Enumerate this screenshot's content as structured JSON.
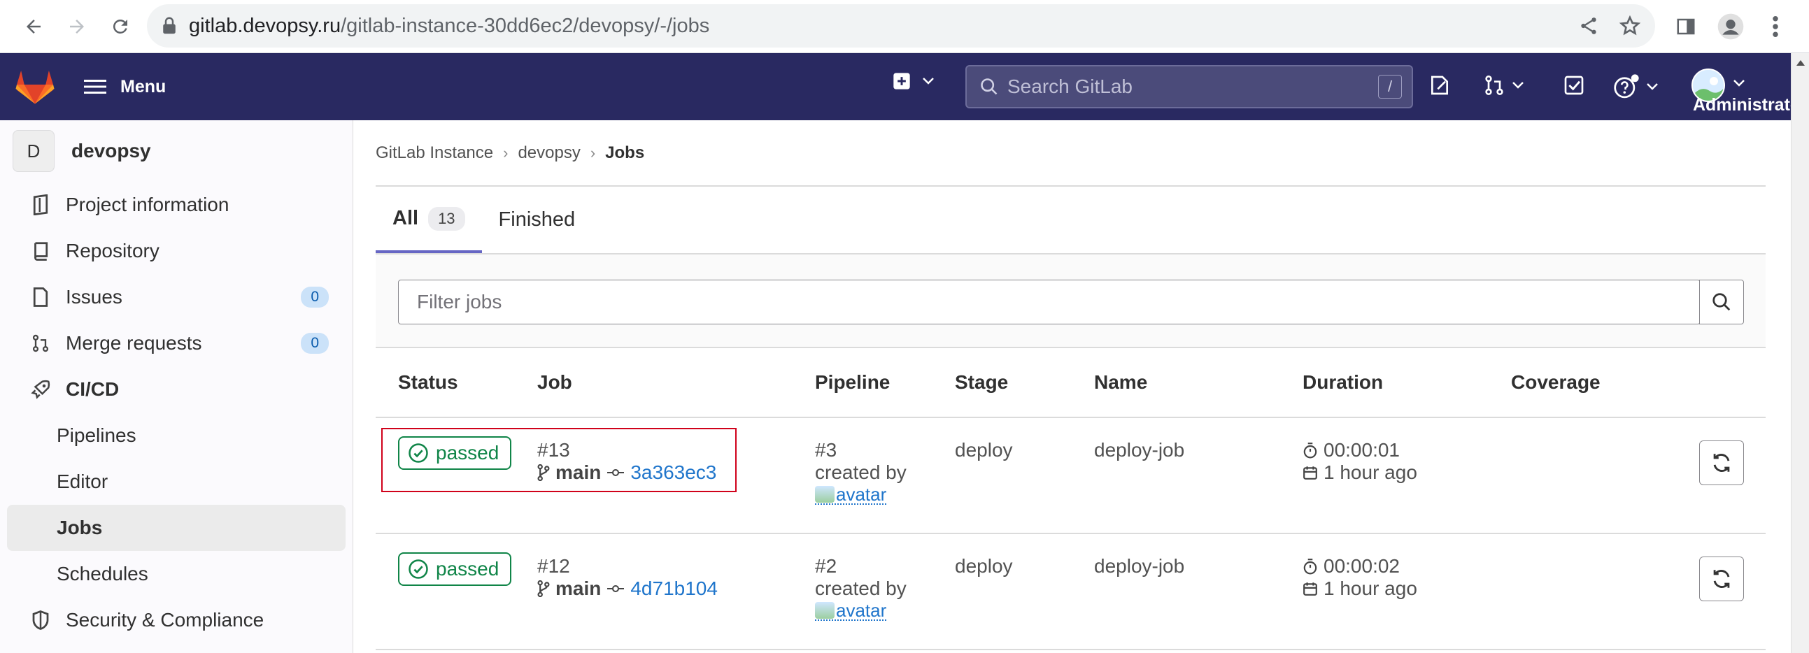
{
  "browser": {
    "url_host": "gitlab.devopsy.ru",
    "url_path": "/gitlab-instance-30dd6ec2/devopsy/-/jobs",
    "icons": [
      "back-icon",
      "forward-icon",
      "reload-icon",
      "lock-icon",
      "share-icon",
      "star-icon",
      "sidepanel-icon",
      "profile-icon",
      "kebab-menu-icon"
    ]
  },
  "topbar": {
    "menu_label": "Menu",
    "search_placeholder": "Search GitLab",
    "search_shortcut": "/",
    "user_label": "Administrator",
    "bg_color": "#292961"
  },
  "sidebar": {
    "project_initial": "D",
    "project_name": "devopsy",
    "items": [
      {
        "label": "Project information",
        "icon": "project-info-icon"
      },
      {
        "label": "Repository",
        "icon": "repository-icon"
      },
      {
        "label": "Issues",
        "icon": "issues-icon",
        "badge": "0"
      },
      {
        "label": "Merge requests",
        "icon": "merge-request-icon",
        "badge": "0"
      },
      {
        "label": "CI/CD",
        "icon": "rocket-icon"
      },
      {
        "label": "Pipelines"
      },
      {
        "label": "Editor"
      },
      {
        "label": "Jobs"
      },
      {
        "label": "Schedules"
      },
      {
        "label": "Security & Compliance",
        "icon": "shield-icon"
      }
    ]
  },
  "breadcrumb": [
    "GitLab Instance",
    "devopsy",
    "Jobs"
  ],
  "tabs": [
    {
      "label": "All",
      "count": "13"
    },
    {
      "label": "Finished"
    }
  ],
  "filter": {
    "placeholder": "Filter jobs"
  },
  "table": {
    "headers": [
      "Status",
      "Job",
      "Pipeline",
      "Stage",
      "Name",
      "Duration",
      "Coverage"
    ],
    "rows": [
      {
        "status": "passed",
        "job_id": "#13",
        "branch": "main",
        "sha": "3a363ec3",
        "pipeline": "#3",
        "created_by": "created by",
        "avatar_alt": "avatar",
        "stage": "deploy",
        "name": "deploy-job",
        "duration": "00:00:01",
        "finished": "1 hour ago"
      },
      {
        "status": "passed",
        "job_id": "#12",
        "branch": "main",
        "sha": "4d71b104",
        "pipeline": "#2",
        "created_by": "created by",
        "avatar_alt": "avatar",
        "stage": "deploy",
        "name": "deploy-job",
        "duration": "00:00:02",
        "finished": "1 hour ago"
      }
    ]
  },
  "colors": {
    "passed": "#108548",
    "link": "#1f75cb",
    "tab_underline": "#6666c4",
    "highlight_box": "#d0021b"
  }
}
